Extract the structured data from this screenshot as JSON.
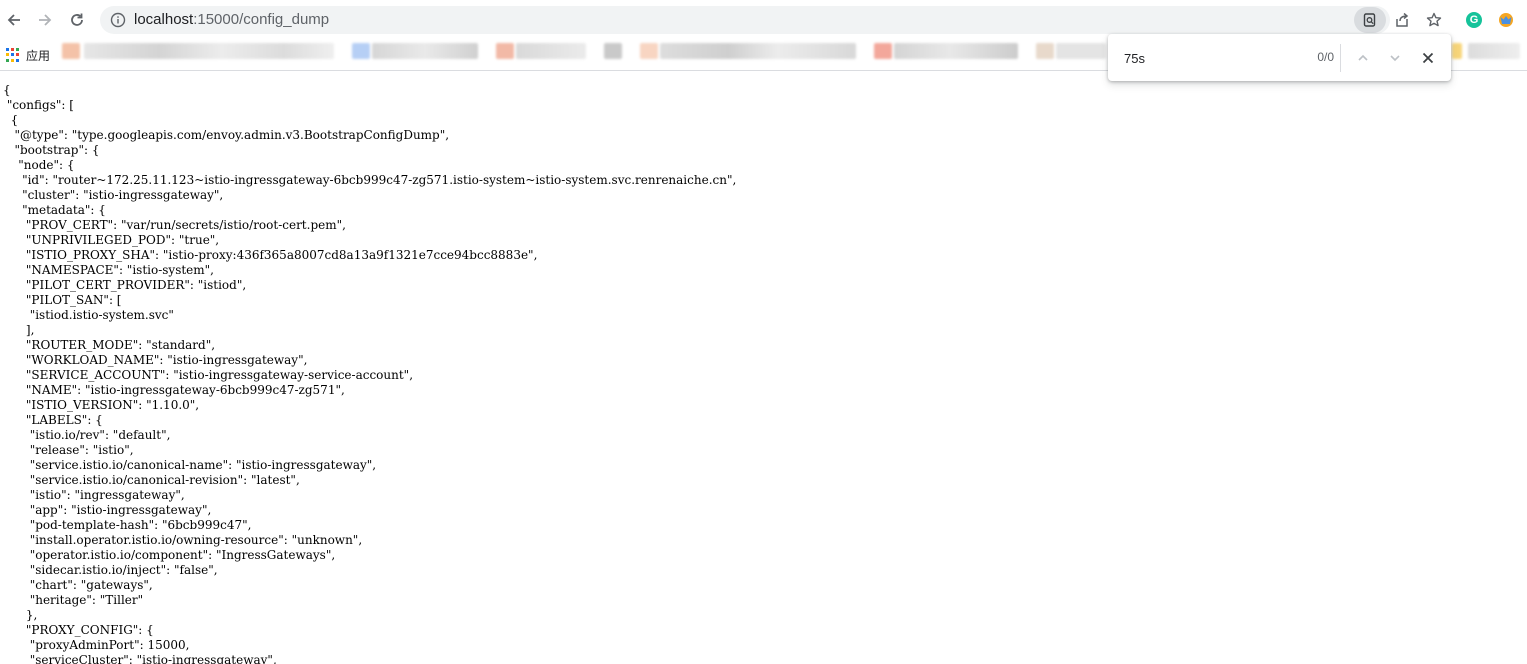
{
  "browser": {
    "url_host": "localhost",
    "url_path": ":15000/config_dump"
  },
  "bookmarks": {
    "apps_label": "应用"
  },
  "find": {
    "query": "75s",
    "count": "0/0"
  },
  "json_lines": [
    "{",
    " \"configs\": [",
    "  {",
    "   \"@type\": \"type.googleapis.com/envoy.admin.v3.BootstrapConfigDump\",",
    "   \"bootstrap\": {",
    "    \"node\": {",
    "     \"id\": \"router~172.25.11.123~istio-ingressgateway-6bcb999c47-zg571.istio-system~istio-system.svc.renrenaiche.cn\",",
    "     \"cluster\": \"istio-ingressgateway\",",
    "     \"metadata\": {",
    "      \"PROV_CERT\": \"var/run/secrets/istio/root-cert.pem\",",
    "      \"UNPRIVILEGED_POD\": \"true\",",
    "      \"ISTIO_PROXY_SHA\": \"istio-proxy:436f365a8007cd8a13a9f1321e7cce94bcc8883e\",",
    "      \"NAMESPACE\": \"istio-system\",",
    "      \"PILOT_CERT_PROVIDER\": \"istiod\",",
    "      \"PILOT_SAN\": [",
    "       \"istiod.istio-system.svc\"",
    "      ],",
    "      \"ROUTER_MODE\": \"standard\",",
    "      \"WORKLOAD_NAME\": \"istio-ingressgateway\",",
    "      \"SERVICE_ACCOUNT\": \"istio-ingressgateway-service-account\",",
    "      \"NAME\": \"istio-ingressgateway-6bcb999c47-zg571\",",
    "      \"ISTIO_VERSION\": \"1.10.0\",",
    "      \"LABELS\": {",
    "       \"istio.io/rev\": \"default\",",
    "       \"release\": \"istio\",",
    "       \"service.istio.io/canonical-name\": \"istio-ingressgateway\",",
    "       \"service.istio.io/canonical-revision\": \"latest\",",
    "       \"istio\": \"ingressgateway\",",
    "       \"app\": \"istio-ingressgateway\",",
    "       \"pod-template-hash\": \"6bcb999c47\",",
    "       \"install.operator.istio.io/owning-resource\": \"unknown\",",
    "       \"operator.istio.io/component\": \"IngressGateways\",",
    "       \"sidecar.istio.io/inject\": \"false\",",
    "       \"chart\": \"gateways\",",
    "       \"heritage\": \"Tiller\"",
    "      },",
    "      \"PROXY_CONFIG\": {",
    "       \"proxyAdminPort\": 15000,",
    "       \"serviceCluster\": \"istio-ingressgateway\","
  ]
}
